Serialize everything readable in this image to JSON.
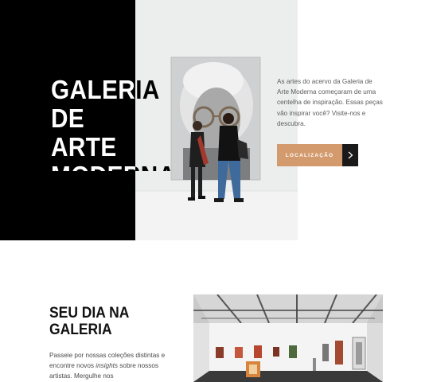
{
  "hero": {
    "title": "GALERIA DE\nARTE\nMODERNA",
    "description": "As artes do acervo da Galeria de Arte Moderna começaram de uma centelha de inspiração. Essas peças vão inspirar você? Visite-nos e descubra.",
    "cta_label": "LOCALIZAÇÃO",
    "cta_arrow_icon": "chevron-right-icon",
    "photo": "visitors-in-front-of-portrait-painting"
  },
  "section": {
    "title": "SEU DIA NA\nGALERIA",
    "body_before": "Passeie por nossas coleções distintas e encontre novos ",
    "body_emphasis": "insights",
    "body_after": " sobre nossos artistas. Mergulhe nos",
    "photo": "gallery-exhibition-room"
  },
  "colors": {
    "black": "#000000",
    "accent": "#d39a6d",
    "arrow_bg": "#1a1a1a",
    "text_muted": "#5c5c5c"
  }
}
